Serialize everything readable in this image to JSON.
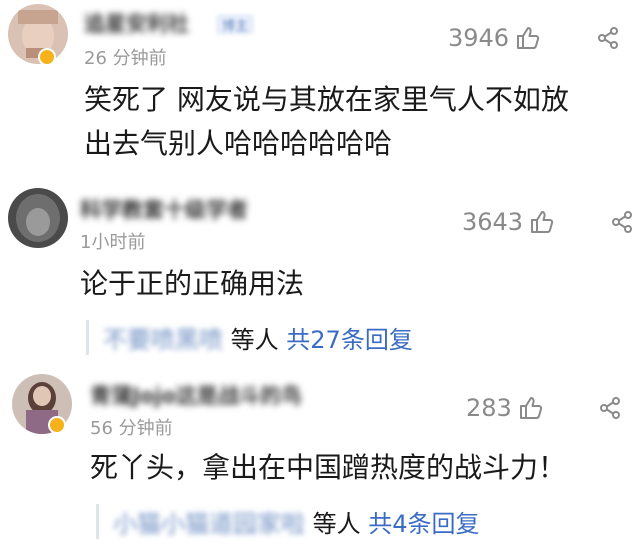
{
  "comments": [
    {
      "username": "追星安利社",
      "user_tag": "博主",
      "time": "26 分钟前",
      "likes": "3946",
      "text_lines": [
        "笑死了 网友说与其放在家里气人不如放",
        "出去气别人哈哈哈哈哈哈"
      ]
    },
    {
      "username": "科学教套十级学者",
      "time": "1小时前",
      "likes": "3643",
      "text_lines": [
        "论于正的正确用法"
      ],
      "reply_names": "不要喷黑喷",
      "reply_middle": "等人",
      "reply_total": "共27条回复"
    },
    {
      "username": "青蒲Jojo这是战斗的鸟",
      "time": "56 分钟前",
      "likes": "283",
      "text_lines": [
        "死丫头，拿出在中国蹭热度的战斗力！"
      ],
      "reply_names": "小猫小猫道园家啦",
      "reply_middle": "等人",
      "reply_total": "共4条回复"
    }
  ],
  "icons": {
    "like": "thumbs-up-icon",
    "share": "share-icon"
  }
}
